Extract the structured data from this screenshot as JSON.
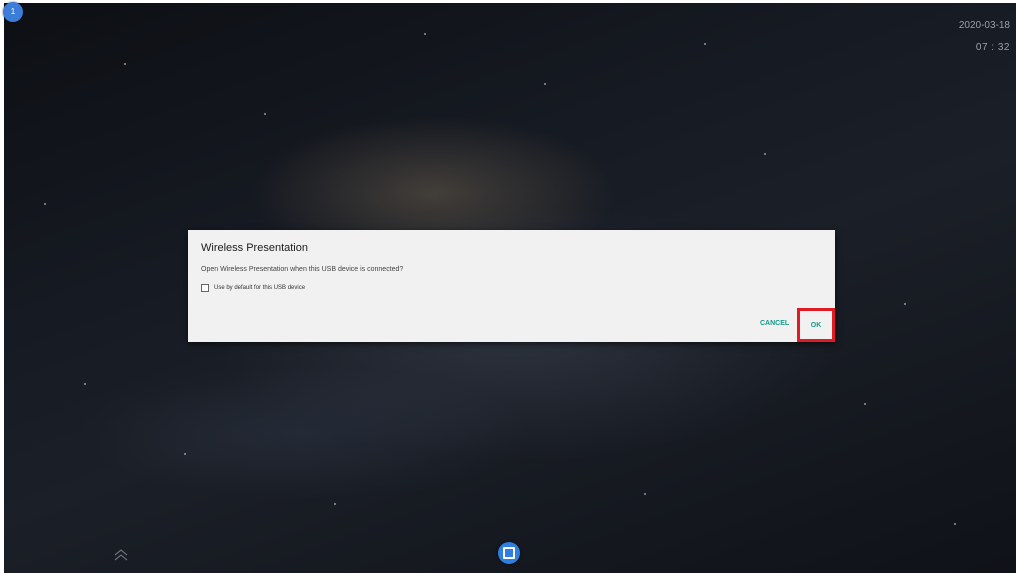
{
  "status": {
    "notification_count": "1",
    "date": "2020-03-18",
    "time": "07 : 32"
  },
  "dialog": {
    "title": "Wireless Presentation",
    "message": "Open Wireless Presentation when this USB device is connected?",
    "checkbox_label": "Use by default for this USB device",
    "checkbox_checked": false,
    "cancel_label": "CANCEL",
    "ok_label": "OK"
  },
  "colors": {
    "accent": "#169a8a",
    "highlight": "#e01b24",
    "home_button": "#2f7fe0"
  },
  "icons": {
    "home": "home-square-icon",
    "up": "chevron-up-double-icon"
  }
}
